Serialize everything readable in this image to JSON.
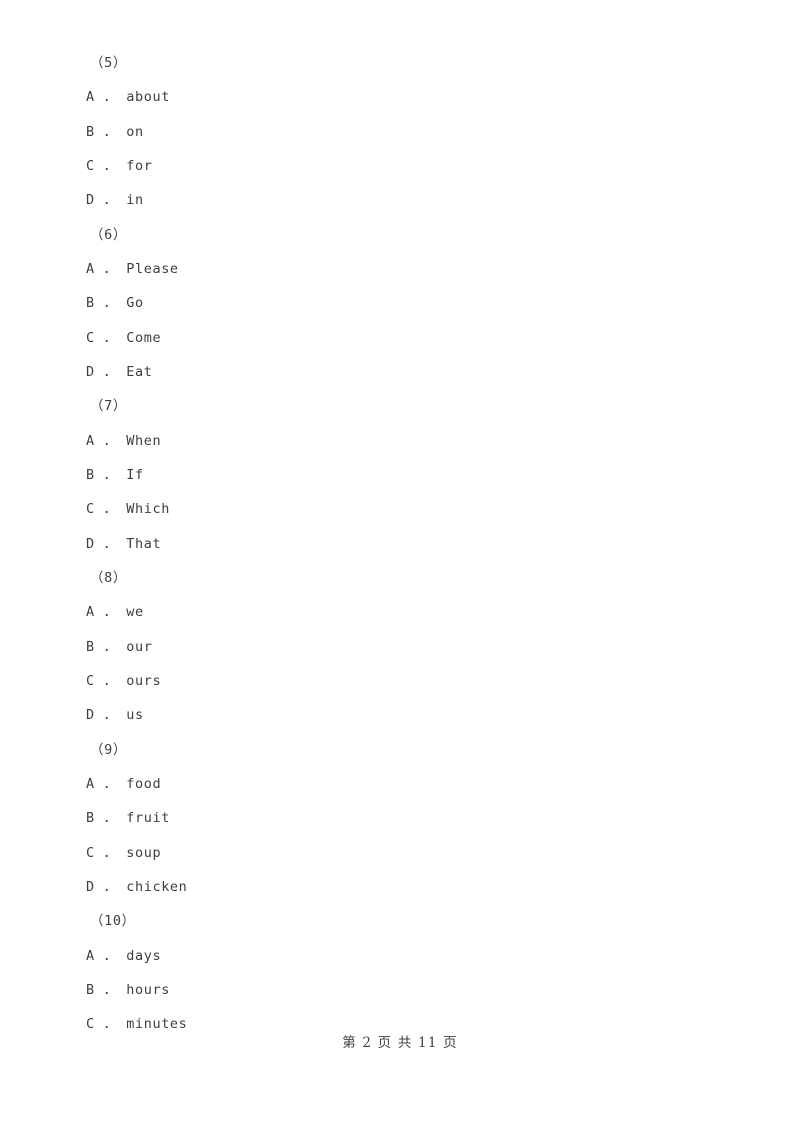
{
  "document": {
    "page_label": "第 2 页 共 11 页",
    "page_number": "2",
    "total_pages": "11",
    "text_color": "#3f3f3f",
    "background_color": "#ffffff"
  },
  "lines": [
    {
      "kind": "question",
      "text": "（5）"
    },
    {
      "kind": "option",
      "text": "A ． about"
    },
    {
      "kind": "option",
      "text": "B ． on"
    },
    {
      "kind": "option",
      "text": "C ． for"
    },
    {
      "kind": "option",
      "text": "D ． in"
    },
    {
      "kind": "question",
      "text": "（6）"
    },
    {
      "kind": "option",
      "text": "A ． Please"
    },
    {
      "kind": "option",
      "text": "B ． Go"
    },
    {
      "kind": "option",
      "text": "C ． Come"
    },
    {
      "kind": "option",
      "text": "D ． Eat"
    },
    {
      "kind": "question",
      "text": "（7）"
    },
    {
      "kind": "option",
      "text": "A ． When"
    },
    {
      "kind": "option",
      "text": "B ． If"
    },
    {
      "kind": "option",
      "text": "C ． Which"
    },
    {
      "kind": "option",
      "text": "D ． That"
    },
    {
      "kind": "question",
      "text": "（8）"
    },
    {
      "kind": "option",
      "text": "A ． we"
    },
    {
      "kind": "option",
      "text": "B ． our"
    },
    {
      "kind": "option",
      "text": "C ． ours"
    },
    {
      "kind": "option",
      "text": "D ． us"
    },
    {
      "kind": "question",
      "text": "（9）"
    },
    {
      "kind": "option",
      "text": "A ． food"
    },
    {
      "kind": "option",
      "text": "B ． fruit"
    },
    {
      "kind": "option",
      "text": "C ． soup"
    },
    {
      "kind": "option",
      "text": "D ． chicken"
    },
    {
      "kind": "question",
      "text": "（10）"
    },
    {
      "kind": "option",
      "text": "A ． days"
    },
    {
      "kind": "option",
      "text": "B ． hours"
    },
    {
      "kind": "option",
      "text": "C ． minutes"
    }
  ]
}
